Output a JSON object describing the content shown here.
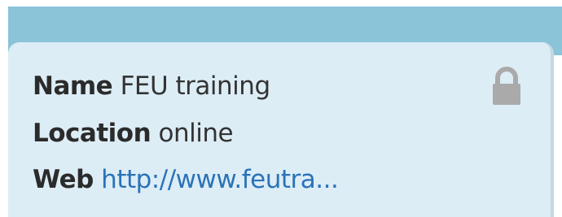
{
  "profile": {
    "name_label": "Name",
    "name_value": "FEU training",
    "location_label": "Location",
    "location_value": "online",
    "web_label": "Web",
    "web_value": "http://www.feutra..."
  },
  "icons": {
    "lock": "lock-icon"
  },
  "colors": {
    "header_strip": "#8bc3d9",
    "card_background": "#ddedf6",
    "link": "#2a73b8",
    "lock_icon": "#aaaaaa"
  }
}
